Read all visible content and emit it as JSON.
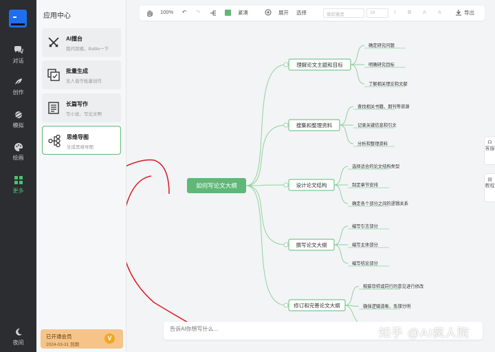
{
  "rail": {
    "items": [
      {
        "label": "对话",
        "icon": "chat-icon"
      },
      {
        "label": "创作",
        "icon": "feather-icon"
      },
      {
        "label": "模拟",
        "icon": "planet-icon"
      },
      {
        "label": "绘画",
        "icon": "palette-icon"
      },
      {
        "label": "更多",
        "icon": "grid-icon",
        "active": true
      }
    ],
    "night_label": "夜间"
  },
  "sidebar": {
    "title": "应用中心",
    "cards": [
      {
        "title": "AI擂台",
        "subtitle": "我问双模，Battle一下",
        "icon": "swords-icon"
      },
      {
        "title": "批量生成",
        "subtitle": "无人值守批量创作",
        "icon": "batch-icon"
      },
      {
        "title": "长篇写作",
        "subtitle": "写小说、写论文啊",
        "icon": "document-icon"
      },
      {
        "title": "思维导图",
        "subtitle": "生成思维导图",
        "icon": "mindmap-icon",
        "active": true
      }
    ],
    "member": {
      "title": "已开通会员",
      "expiry": "2024-03-31 到期",
      "badge": "V"
    }
  },
  "toolbar": {
    "zoom": "100%",
    "theme_label": "紧凑",
    "expand_label": "展开",
    "select_label": "选择",
    "font_placeholder": "微软雅黑",
    "size_placeholder": "16",
    "italic": "I",
    "bold": "B",
    "font_color": "A",
    "highlight": "A",
    "export_label": "导出",
    "accent": "#5fb878"
  },
  "mindmap": {
    "root": "如何写论文大纲",
    "branches": [
      {
        "label": "理解论文主题和目标",
        "children": [
          "确定研究问题",
          "明确研究目标",
          "了解相关理论和文献"
        ]
      },
      {
        "label": "搜集和整理资料",
        "children": [
          "查找相关书籍、期刊等资源",
          "记录关键信息和引文",
          "分析和整理资料"
        ]
      },
      {
        "label": "设计论文结构",
        "children": [
          "选择适合的论文结构类型",
          "制定章节安排",
          "确定各个部分之间的逻辑关系"
        ]
      },
      {
        "label": "撰写论文大纲",
        "children": [
          "编写引言部分",
          "编写主体部分",
          "编写结论部分"
        ]
      },
      {
        "label": "修订和完善论文大纲",
        "children": [
          "根据导师或同行的意见进行修改",
          "确保逻辑清晰、条理分明"
        ]
      }
    ]
  },
  "right_panel": {
    "feedback": "客服",
    "tutorial": "教程"
  },
  "prompt": {
    "placeholder": "告诉AI你想写什么..."
  },
  "watermark": "知乎 @AI疯人院"
}
